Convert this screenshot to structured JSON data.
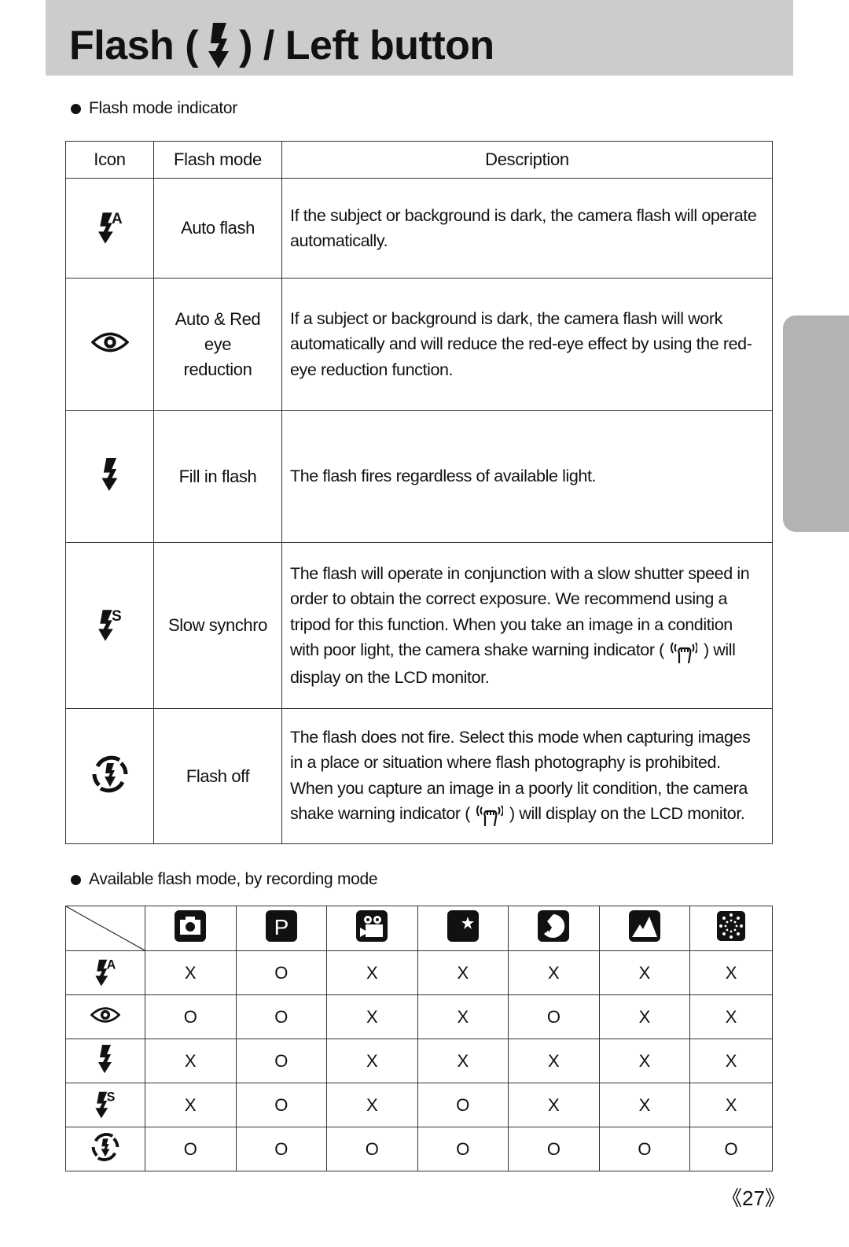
{
  "header": {
    "title_prefix": "Flash (",
    "title_icon": "flash-icon",
    "title_suffix": ") / Left button"
  },
  "section1": {
    "label": "Flash mode indicator",
    "columns": [
      "Icon",
      "Flash mode",
      "Description"
    ],
    "rows": [
      {
        "icon": "auto-flash-icon",
        "mode": "Auto flash",
        "desc": "If the subject or background is dark, the camera flash will operate automatically."
      },
      {
        "icon": "red-eye-icon",
        "mode": "Auto & Red eye reduction",
        "desc": "If a subject or background is dark, the camera flash will work automatically and will reduce the red-eye effect by using the red-eye reduction function."
      },
      {
        "icon": "fill-flash-icon",
        "mode": "Fill in flash",
        "desc": "The flash fires regardless of available light."
      },
      {
        "icon": "slow-synchro-icon",
        "mode": "Slow synchro",
        "desc_before": "The flash will operate in conjunction with a slow shutter speed in order to obtain the correct exposure. We recommend using a tripod for this function. When you take an image in a condition with poor light, the camera shake warning indicator (",
        "desc_icon": "camera-shake-icon",
        "desc_after": ") will display on the LCD monitor."
      },
      {
        "icon": "flash-off-icon",
        "mode": "Flash off",
        "desc_before": "The flash does not fire. Select this mode when capturing images in a place or situation where flash photography is prohibited. When you capture an image in a poorly lit condition, the camera shake warning indicator (",
        "desc_icon": "camera-shake-icon",
        "desc_after": ") will display on the LCD monitor."
      }
    ]
  },
  "section2": {
    "label": "Available flash mode, by recording mode",
    "recording_modes": [
      "auto-mode-icon",
      "program-mode-icon",
      "movie-mode-icon",
      "night-scene-icon",
      "portrait-icon",
      "landscape-icon",
      "fireworks-icon"
    ],
    "rows": [
      {
        "icon": "auto-flash-icon",
        "values": [
          "X",
          "O",
          "X",
          "X",
          "X",
          "X",
          "X"
        ]
      },
      {
        "icon": "red-eye-icon",
        "values": [
          "O",
          "O",
          "X",
          "X",
          "O",
          "X",
          "X"
        ]
      },
      {
        "icon": "fill-flash-icon",
        "values": [
          "X",
          "O",
          "X",
          "X",
          "X",
          "X",
          "X"
        ]
      },
      {
        "icon": "slow-synchro-icon",
        "values": [
          "X",
          "O",
          "X",
          "O",
          "X",
          "X",
          "X"
        ]
      },
      {
        "icon": "flash-off-icon",
        "values": [
          "O",
          "O",
          "O",
          "O",
          "O",
          "O",
          "O"
        ]
      }
    ]
  },
  "page": {
    "number": "《27》"
  }
}
